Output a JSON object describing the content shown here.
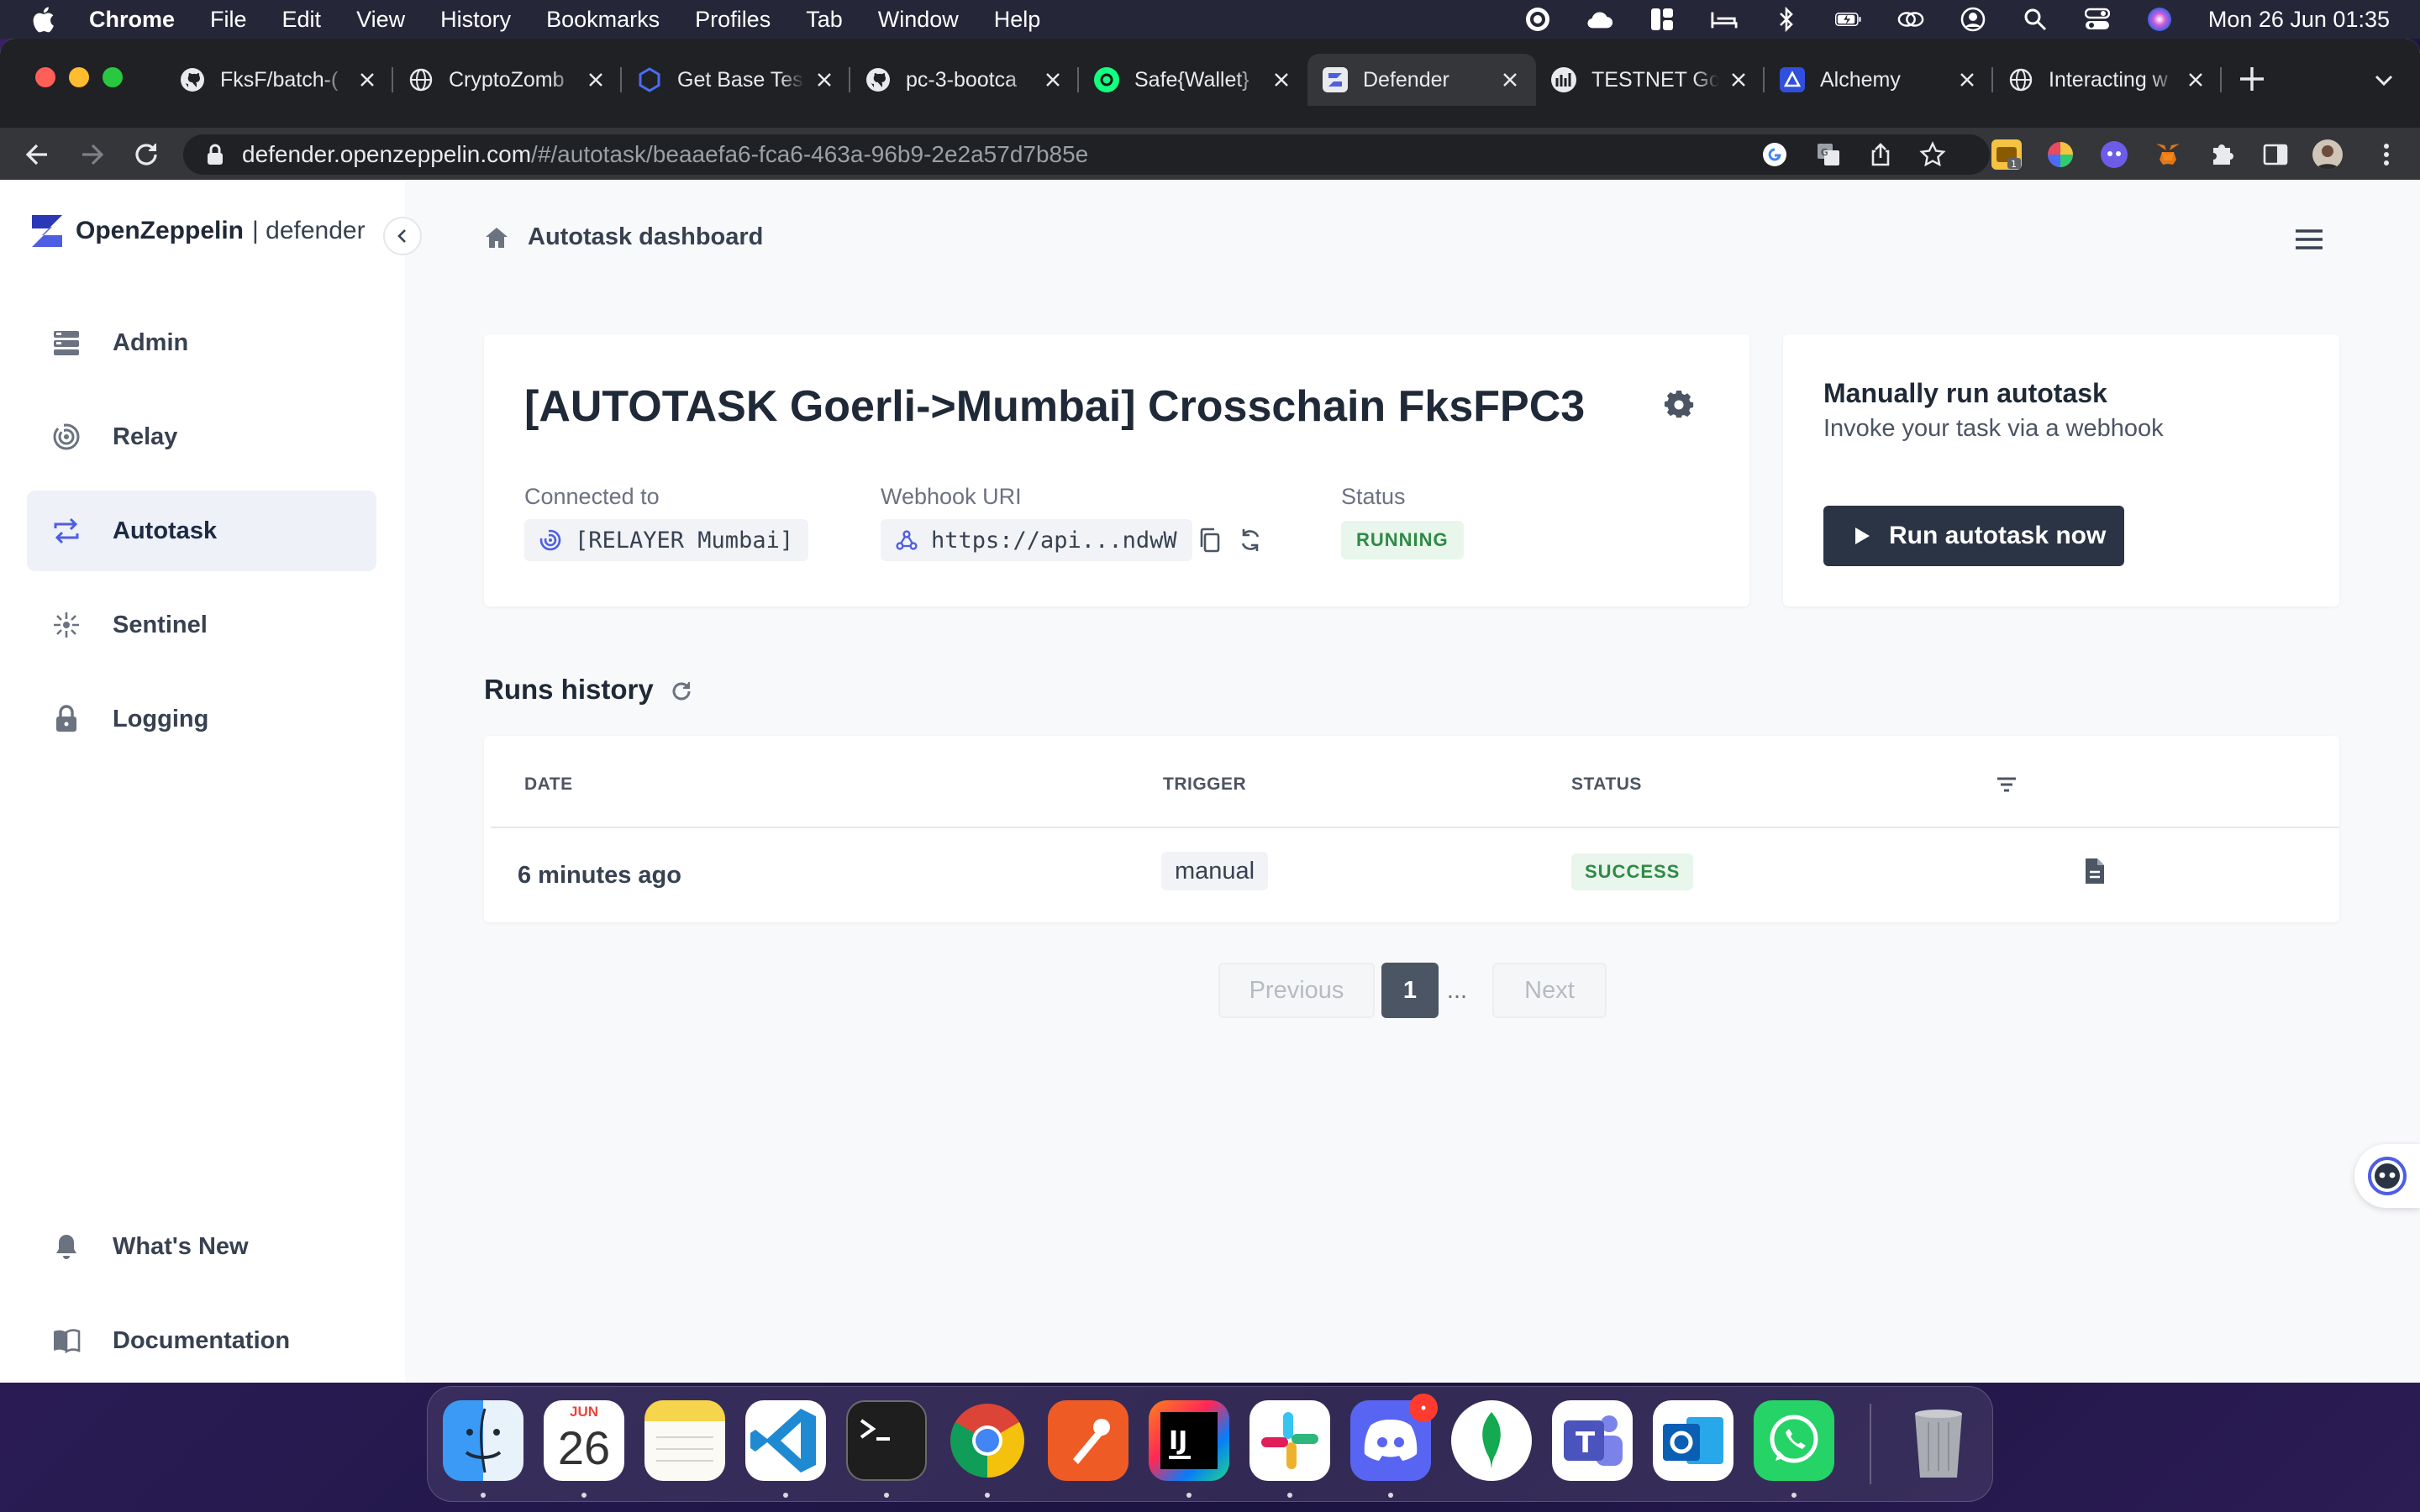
{
  "menubar": {
    "app_name": "Chrome",
    "items": [
      "File",
      "Edit",
      "View",
      "History",
      "Bookmarks",
      "Profiles",
      "Tab",
      "Window",
      "Help"
    ],
    "clock": "Mon 26 Jun  01:35"
  },
  "browser": {
    "tabs": [
      {
        "title": "FksF/batch-(",
        "icon": "github-icon"
      },
      {
        "title": "CryptoZomb",
        "icon": "globe-icon"
      },
      {
        "title": "Get Base Tes",
        "icon": "base-hex-icon"
      },
      {
        "title": "pc-3-bootca",
        "icon": "github-icon"
      },
      {
        "title": "Safe{Wallet}",
        "icon": "safe-icon"
      },
      {
        "title": "Defender",
        "icon": "openzeppelin-icon",
        "active": true
      },
      {
        "title": "TESTNET Go",
        "icon": "faucet-icon"
      },
      {
        "title": "Alchemy",
        "icon": "alchemy-icon"
      },
      {
        "title": "Interacting w",
        "icon": "globe-icon"
      }
    ],
    "url_host": "defender.openzeppelin.com",
    "url_path": "/#/autotask/beaaefa6-fca6-463a-96b9-2e2a57d7b85e",
    "extension_badge": "1"
  },
  "sidebar": {
    "brand_name": "OpenZeppelin",
    "brand_product": "| defender",
    "items": [
      {
        "label": "Admin",
        "icon": "admin-icon"
      },
      {
        "label": "Relay",
        "icon": "relay-icon"
      },
      {
        "label": "Autotask",
        "icon": "autotask-icon",
        "active": true
      },
      {
        "label": "Sentinel",
        "icon": "sentinel-icon"
      },
      {
        "label": "Logging",
        "icon": "lock-icon"
      }
    ],
    "bottom_items": [
      {
        "label": "What's New",
        "icon": "bell-icon"
      },
      {
        "label": "Documentation",
        "icon": "book-icon"
      }
    ]
  },
  "main": {
    "breadcrumb": "Autotask dashboard",
    "task": {
      "title": "[AUTOTASK Goerli->Mumbai] Crosschain FksFPC3",
      "connected_label": "Connected to",
      "connected_value": "[RELAYER Mumbai]",
      "webhook_label": "Webhook URI",
      "webhook_value": "https://api...ndwW",
      "status_label": "Status",
      "status_value": "RUNNING"
    },
    "manual_run": {
      "title": "Manually run autotask",
      "subtitle": "Invoke your task via a webhook",
      "button_label": "Run autotask now"
    },
    "runs_history": {
      "title": "Runs history",
      "columns": [
        "DATE",
        "TRIGGER",
        "STATUS"
      ],
      "rows": [
        {
          "date": "6 minutes ago",
          "trigger": "manual",
          "status": "SUCCESS"
        }
      ],
      "pagination": {
        "previous": "Previous",
        "current": "1",
        "ellipsis": "...",
        "next": "Next"
      }
    }
  },
  "dock": {
    "calendar_month": "JUN",
    "calendar_day": "26",
    "discord_badge": "•",
    "apps": [
      "Finder",
      "Calendar",
      "Notes",
      "Visual Studio Code",
      "Terminal",
      "Google Chrome",
      "Postman",
      "IntelliJ IDEA",
      "Slack",
      "Discord",
      "MongoDB Compass",
      "Microsoft Teams",
      "Microsoft Outlook",
      "WhatsApp",
      "Trash"
    ]
  },
  "colors": {
    "accent_navy": "#2b3444",
    "success_green": "#2f8a46",
    "success_bg": "#e8f6ec",
    "sidebar_active_bg": "#eef1f8",
    "brand_blue": "#4e5ee4"
  }
}
